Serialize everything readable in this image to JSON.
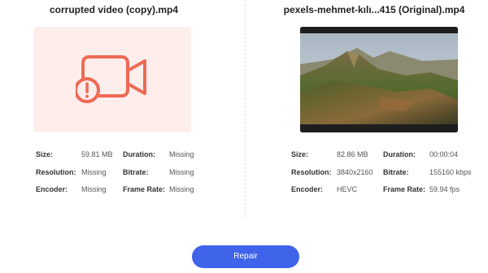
{
  "left": {
    "filename": "corrupted video (copy).mp4",
    "info": [
      {
        "label": "Size:",
        "value": "59.81 MB",
        "label2": "Duration:",
        "value2": "Missing"
      },
      {
        "label": "Resolution:",
        "value": "Missing",
        "label2": "Bitrate:",
        "value2": "Missing"
      },
      {
        "label": "Encoder:",
        "value": "Missing",
        "label2": "Frame Rate:",
        "value2": "Missing"
      }
    ],
    "icon": "broken-video-icon",
    "icon_color": "#ef6a55",
    "box_color": "#fdeeec"
  },
  "right": {
    "filename": "pexels-mehmet-kılı...415 (Original).mp4",
    "info": [
      {
        "label": "Size:",
        "value": "82.86 MB",
        "label2": "Duration:",
        "value2": "00:00:04"
      },
      {
        "label": "Resolution:",
        "value": "3840x2160",
        "label2": "Bitrate:",
        "value2": "155160 kbps"
      },
      {
        "label": "Encoder:",
        "value": "HEVC",
        "label2": "Frame Rate:",
        "value2": "59.94 fps"
      }
    ]
  },
  "actions": {
    "repair_label": "Repair"
  },
  "colors": {
    "accent": "#3f63e9",
    "error": "#ef6a55"
  }
}
